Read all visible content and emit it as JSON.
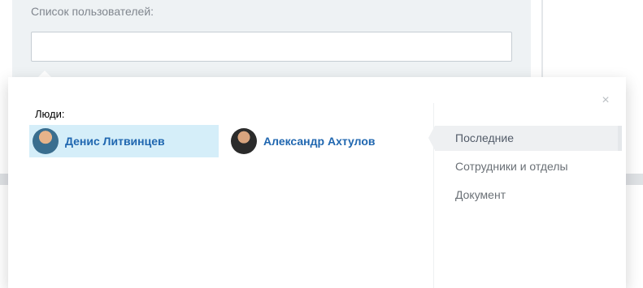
{
  "form": {
    "users_label": "Список пользователей:",
    "users_input_value": ""
  },
  "popup": {
    "close_label": "×",
    "section_label": "Люди:",
    "users": [
      {
        "name": "Денис Литвинцев",
        "selected": true,
        "avatar": "user-avatar-photo"
      },
      {
        "name": "Александр Ахтулов",
        "selected": false,
        "avatar": "user-avatar-photo"
      }
    ],
    "tabs": [
      {
        "label": "Последние",
        "active": true
      },
      {
        "label": "Сотрудники и отделы",
        "active": false
      },
      {
        "label": "Документ",
        "active": false
      }
    ]
  },
  "colors": {
    "link": "#2067b0",
    "selected_bg": "#d5eef9",
    "form_bg": "#eef2f4"
  }
}
